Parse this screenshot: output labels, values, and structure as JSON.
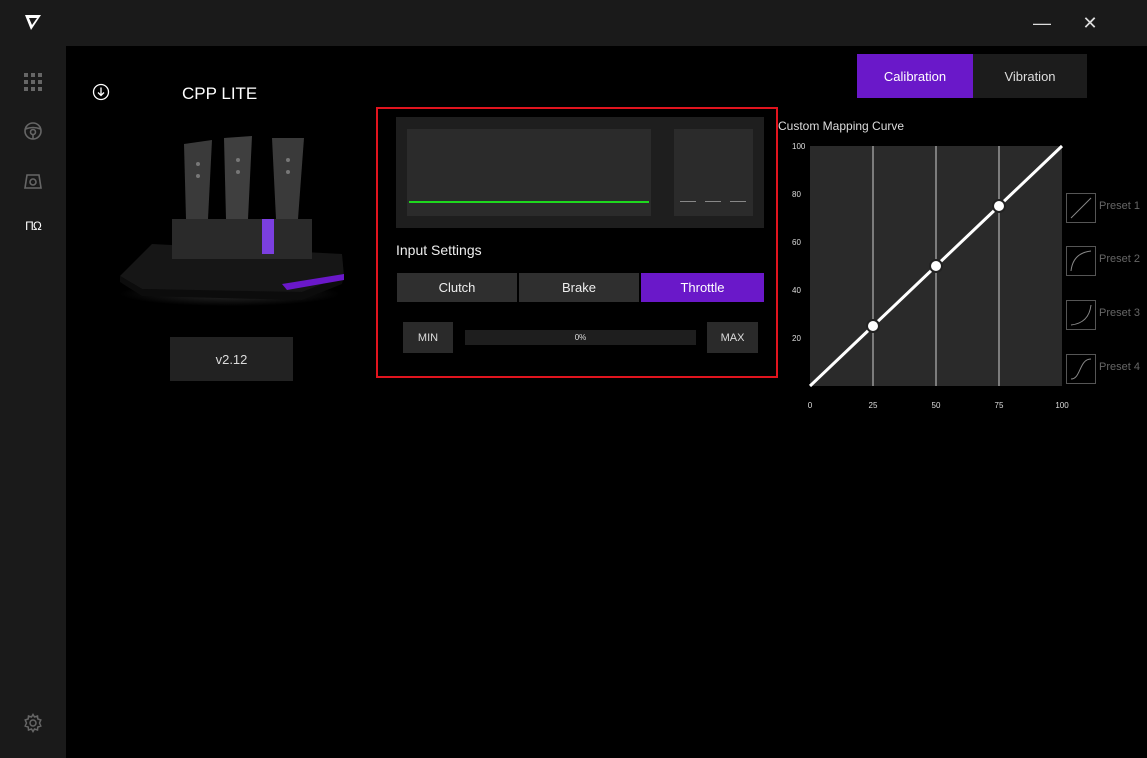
{
  "window": {
    "minimize_glyph": "—",
    "close_glyph": "✕"
  },
  "sidebar": {
    "logo_icon": "logo-icon",
    "items": [
      {
        "name": "grid-icon"
      },
      {
        "name": "steering-wheel-icon"
      },
      {
        "name": "wheelbase-icon"
      },
      {
        "name": "pedals-icon",
        "glyph": "ΠΩ",
        "active": true
      }
    ],
    "settings_icon": "gear-icon"
  },
  "device": {
    "name": "CPP LITE",
    "version": "v2.12"
  },
  "tabs": [
    {
      "label": "Calibration",
      "active": true
    },
    {
      "label": "Vibration",
      "active": false
    }
  ],
  "input_settings": {
    "title": "Input Settings",
    "pedals": [
      {
        "label": "Clutch",
        "active": false
      },
      {
        "label": "Brake",
        "active": false
      },
      {
        "label": "Throttle",
        "active": true
      }
    ],
    "min_label": "MIN",
    "max_label": "MAX",
    "progress_text": "0%",
    "progress_value": 0
  },
  "curve": {
    "title": "Custom Mapping Curve",
    "x_ticks": [
      "0",
      "25",
      "50",
      "75",
      "100"
    ],
    "y_ticks": [
      "20",
      "40",
      "60",
      "80",
      "100"
    ],
    "points": [
      {
        "x": 0,
        "y": 0
      },
      {
        "x": 25,
        "y": 25
      },
      {
        "x": 50,
        "y": 50
      },
      {
        "x": 75,
        "y": 75
      },
      {
        "x": 100,
        "y": 100
      }
    ],
    "handles": [
      25,
      50,
      75
    ]
  },
  "presets": [
    {
      "label": "Preset 1",
      "icon": "linear-curve-icon"
    },
    {
      "label": "Preset 2",
      "icon": "ease-out-curve-icon"
    },
    {
      "label": "Preset 3",
      "icon": "ease-in-curve-icon"
    },
    {
      "label": "Preset 4",
      "icon": "s-curve-icon"
    }
  ],
  "colors": {
    "accent": "#6a18c9",
    "highlight": "#e1141e",
    "meter": "#1ed81e"
  }
}
